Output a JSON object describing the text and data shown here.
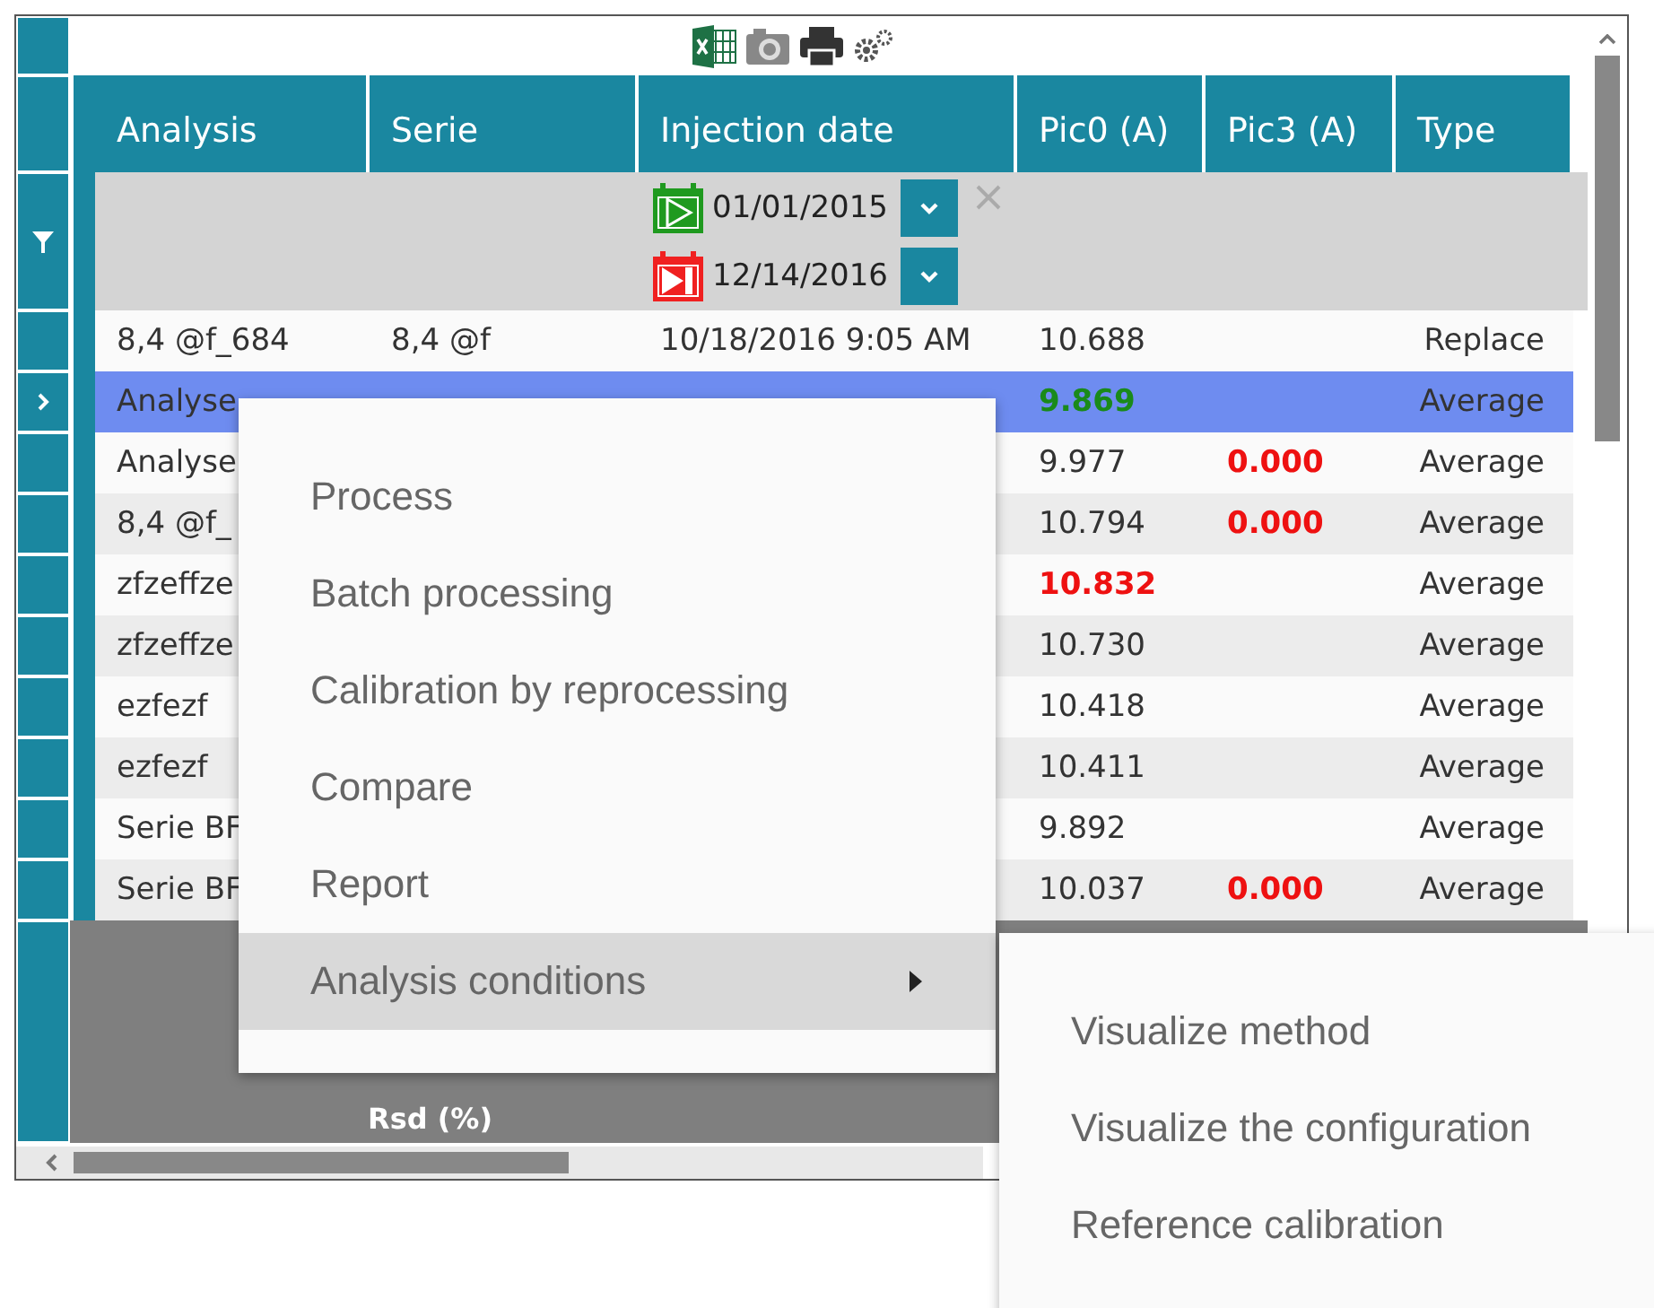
{
  "table": {
    "columns": [
      "Analysis",
      "Serie",
      "Injection date",
      "Pic0 (A)",
      "Pic3 (A)",
      "Type"
    ],
    "date_filter": {
      "from": "01/01/2015",
      "to": "12/14/2016"
    },
    "rows": [
      {
        "selected": false,
        "cells": [
          {
            "text": "8,4 @f_684"
          },
          {
            "text": "8,4 @f"
          },
          {
            "text": "10/18/2016 9:05 AM"
          },
          {
            "text": "10.688"
          },
          {
            "text": ""
          },
          {
            "text": "Replace"
          }
        ]
      },
      {
        "selected": true,
        "cells": [
          {
            "text": "Analyse"
          },
          {
            "text": ""
          },
          {
            "text": ""
          },
          {
            "text": "9.869",
            "color": "#1a8a1a"
          },
          {
            "text": ""
          },
          {
            "text": "Average"
          }
        ]
      },
      {
        "selected": false,
        "cells": [
          {
            "text": "Analyse"
          },
          {
            "text": ""
          },
          {
            "text": ""
          },
          {
            "text": "9.977"
          },
          {
            "text": "0.000",
            "color": "#ee1111"
          },
          {
            "text": "Average"
          }
        ]
      },
      {
        "selected": false,
        "cells": [
          {
            "text": "8,4 @f_"
          },
          {
            "text": ""
          },
          {
            "text": ""
          },
          {
            "text": "10.794"
          },
          {
            "text": "0.000",
            "color": "#ee1111"
          },
          {
            "text": "Average"
          }
        ]
      },
      {
        "selected": false,
        "cells": [
          {
            "text": "zfzeffze"
          },
          {
            "text": ""
          },
          {
            "text": ""
          },
          {
            "text": "10.832",
            "color": "#ee1111"
          },
          {
            "text": ""
          },
          {
            "text": "Average"
          }
        ]
      },
      {
        "selected": false,
        "cells": [
          {
            "text": "zfzeffze"
          },
          {
            "text": ""
          },
          {
            "text": ""
          },
          {
            "text": "10.730"
          },
          {
            "text": ""
          },
          {
            "text": "Average"
          }
        ]
      },
      {
        "selected": false,
        "cells": [
          {
            "text": "ezfezf"
          },
          {
            "text": ""
          },
          {
            "text": ""
          },
          {
            "text": "10.418"
          },
          {
            "text": ""
          },
          {
            "text": "Average"
          }
        ]
      },
      {
        "selected": false,
        "cells": [
          {
            "text": "ezfezf"
          },
          {
            "text": ""
          },
          {
            "text": ""
          },
          {
            "text": "10.411"
          },
          {
            "text": ""
          },
          {
            "text": "Average"
          }
        ]
      },
      {
        "selected": false,
        "cells": [
          {
            "text": "Serie BF"
          },
          {
            "text": ""
          },
          {
            "text": ""
          },
          {
            "text": "9.892"
          },
          {
            "text": ""
          },
          {
            "text": "Average"
          }
        ]
      },
      {
        "selected": false,
        "cells": [
          {
            "text": "Serie BF"
          },
          {
            "text": ""
          },
          {
            "text": ""
          },
          {
            "text": "10.037"
          },
          {
            "text": "0.000",
            "color": "#ee1111"
          },
          {
            "text": "Average"
          }
        ]
      }
    ],
    "footer_label": "Rsd (%)"
  },
  "context_menu": {
    "items": [
      {
        "label": "Process",
        "selected": false,
        "submenu": false
      },
      {
        "label": "Batch processing",
        "selected": false,
        "submenu": false
      },
      {
        "label": "Calibration by reprocessing",
        "selected": false,
        "submenu": false
      },
      {
        "label": "Compare",
        "selected": false,
        "submenu": false
      },
      {
        "label": "Report",
        "selected": false,
        "submenu": false
      },
      {
        "label": "Analysis conditions",
        "selected": true,
        "submenu": true
      }
    ]
  },
  "submenu": {
    "items": [
      {
        "label": "Visualize method"
      },
      {
        "label": "Visualize the configuration"
      },
      {
        "label": "Reference calibration"
      }
    ]
  }
}
